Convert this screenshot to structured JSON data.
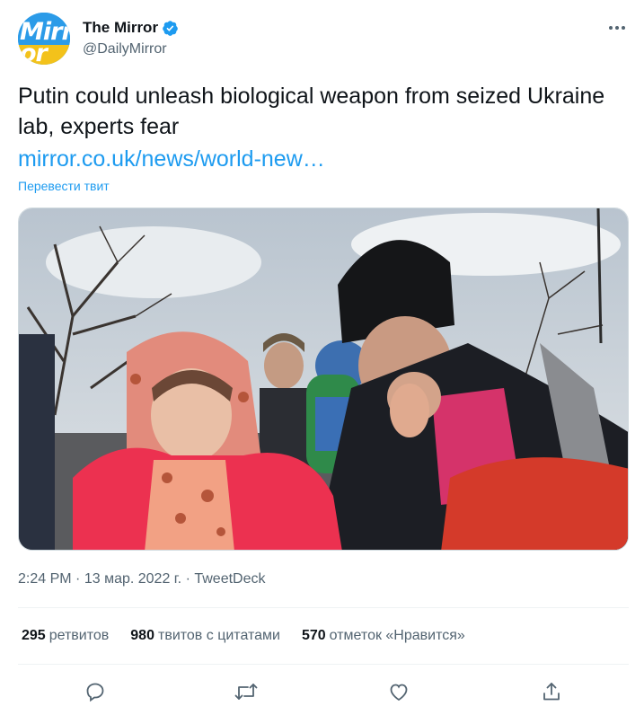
{
  "author": {
    "display_name": "The Mirror",
    "handle": "@DailyMirror",
    "avatar_text_top": "Mirr",
    "avatar_text_bottom": "or"
  },
  "tweet": {
    "text": "Putin could unleash biological weapon from seized Ukraine lab, experts fear",
    "link": "mirror.co.uk/news/world-new…",
    "translate": "Перевести твит"
  },
  "meta": {
    "time": "2:24 PM",
    "separator": "·",
    "date": "13 мар. 2022 г.",
    "source": "TweetDeck"
  },
  "stats": {
    "retweets_count": "295",
    "retweets_label": "ретвитов",
    "quotes_count": "980",
    "quotes_label": "твитов с цитатами",
    "likes_count": "570",
    "likes_label": "отметок «Нравится»"
  },
  "icons": {
    "more": "more-icon",
    "verified": "verified-badge-icon",
    "reply": "reply-icon",
    "retweet": "retweet-icon",
    "like": "like-icon",
    "share": "share-icon"
  },
  "colors": {
    "accent": "#1d9bf0",
    "text": "#0f1419",
    "secondary": "#536471",
    "divider": "#eff3f4"
  }
}
